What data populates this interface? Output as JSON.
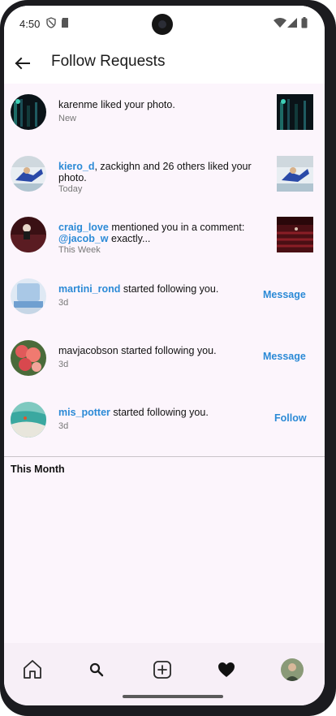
{
  "status_bar": {
    "time": "4:50"
  },
  "header": {
    "title": "Follow Requests"
  },
  "notifications": [
    {
      "avatar": "dark-photo",
      "user": "",
      "text": "karenme liked your photo.",
      "time": "New",
      "thumbnail": "dark-photo"
    },
    {
      "avatar": "kiero-photo",
      "user": "kiero_d",
      "text": ", zackighn and 26 others liked your photo.",
      "time": "Today",
      "thumbnail": "kiero-photo"
    },
    {
      "avatar": "craig-photo",
      "user": "craig_love",
      "text": " mentioned you in a comment:",
      "mention": "@jacob_w",
      "mention_text": " exactly...",
      "time": "This Week",
      "thumbnail": "theater-photo"
    },
    {
      "avatar": "martini-photo",
      "user": "martini_rond",
      "text": " started following you.",
      "time": "3d",
      "action": "Message"
    },
    {
      "avatar": "flowers-photo",
      "user": "",
      "text": "mavjacobson started following you.",
      "time": "3d",
      "action": "Message"
    },
    {
      "avatar": "beach-photo",
      "user": "mis_potter",
      "text": " started following you.",
      "time": "3d",
      "action": "Follow"
    }
  ],
  "section": {
    "label": "This Month"
  },
  "bottom_nav": [
    {
      "icon": "home-icon"
    },
    {
      "icon": "search-icon"
    },
    {
      "icon": "add-post-icon"
    },
    {
      "icon": "heart-icon"
    },
    {
      "icon": "profile-avatar"
    }
  ],
  "colors": {
    "accent": "#2b8ad6",
    "background": "#fcf5fc"
  }
}
